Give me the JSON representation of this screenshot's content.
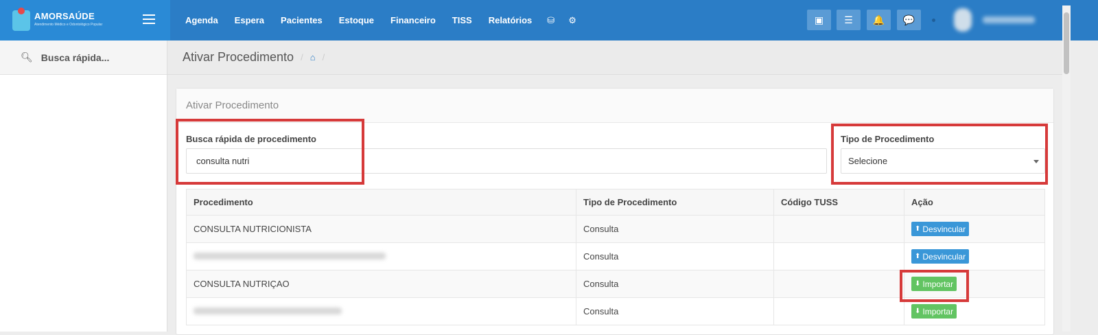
{
  "brand": {
    "name": "AMORSAÚDE",
    "sub": "Atendimento Médico e Odontológico Popular"
  },
  "nav": {
    "items": [
      "Agenda",
      "Espera",
      "Pacientes",
      "Estoque",
      "Financeiro",
      "TISS",
      "Relatórios"
    ]
  },
  "sidebar": {
    "search_label": "Busca rápida..."
  },
  "page": {
    "title": "Ativar Procedimento"
  },
  "panel": {
    "heading": "Ativar Procedimento",
    "search_label": "Busca rápida de procedimento",
    "search_value": "consulta nutri",
    "type_label": "Tipo de Procedimento",
    "type_value": "Selecione"
  },
  "table": {
    "headers": [
      "Procedimento",
      "Tipo de Procedimento",
      "Código TUSS",
      "Ação"
    ],
    "rows": [
      {
        "name": "CONSULTA NUTRICIONISTA",
        "type": "Consulta",
        "tuss": "",
        "action": "Desvincular"
      },
      {
        "name": "",
        "type": "Consulta",
        "tuss": "",
        "action": "Desvincular"
      },
      {
        "name": "CONSULTA NUTRIÇAO",
        "type": "Consulta",
        "tuss": "",
        "action": "Importar"
      },
      {
        "name": "",
        "type": "Consulta",
        "tuss": "",
        "action": "Importar"
      }
    ]
  },
  "colors": {
    "topbar": "#2b7dc6",
    "brand": "#2a8ad6",
    "highlight": "#d63a3a",
    "btn_blue": "#3a97d8",
    "btn_green": "#62c462"
  },
  "icons": [
    "search-icon",
    "menu-icon",
    "database-icon",
    "gear-icon",
    "inbox-icon",
    "list-icon",
    "bell-icon",
    "chat-icon",
    "home-icon",
    "upload-icon",
    "download-icon"
  ]
}
